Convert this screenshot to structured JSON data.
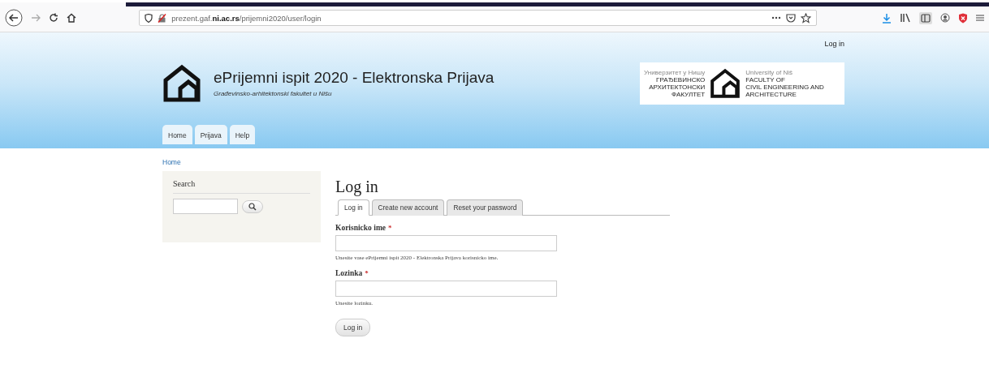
{
  "browser": {
    "url": "prezent.gaf.**ni.ac.rs**/prijemni2020/user/login"
  },
  "header": {
    "user_menu": [
      "Log in"
    ],
    "site_name": "ePrijemni ispit 2020 - Elektronska Prijava",
    "slogan": "Građevinsko-arhitektonski fakultet u Nišu",
    "partner_logo": {
      "left_lines": [
        "Универзитет у Нишу",
        "ГРАЂЕВИНСКО",
        "АРХИТЕКТОНСКИ",
        "ФАКУЛТЕТ"
      ],
      "right_lines": [
        "University of Niš",
        "FACULTY OF",
        "CIVIL ENGINEERING AND",
        "ARCHITECTURE"
      ]
    },
    "nav": [
      "Home",
      "Prijava",
      "Help"
    ]
  },
  "breadcrumb": [
    "Home"
  ],
  "sidebar": {
    "title": "Search"
  },
  "main": {
    "title": "Log in",
    "tabs": [
      {
        "label": "Log in",
        "selected": true
      },
      {
        "label": "Create new account",
        "selected": false
      },
      {
        "label": "Reset your password",
        "selected": false
      }
    ],
    "fields": [
      {
        "label": "Korisnicko ime",
        "required_mark": "*",
        "description": "Unesite vase ePrijemni ispit 2020 - Elektronska Prijava korisnicko ime."
      },
      {
        "label": "Lozinka",
        "required_mark": "*",
        "description": "Unesite lozinku."
      }
    ],
    "submit": "Log in"
  }
}
